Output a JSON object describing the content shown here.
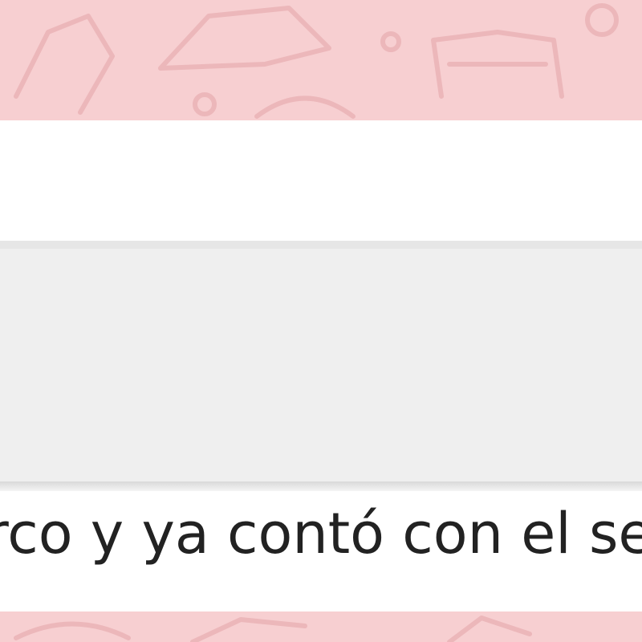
{
  "chat": {
    "message_fragment": "rco y ya contó con el ser"
  },
  "colors": {
    "wallpaper": "#f7cfd1",
    "bubble": "#ffffff",
    "media_placeholder": "#efefef",
    "text": "#222222"
  }
}
